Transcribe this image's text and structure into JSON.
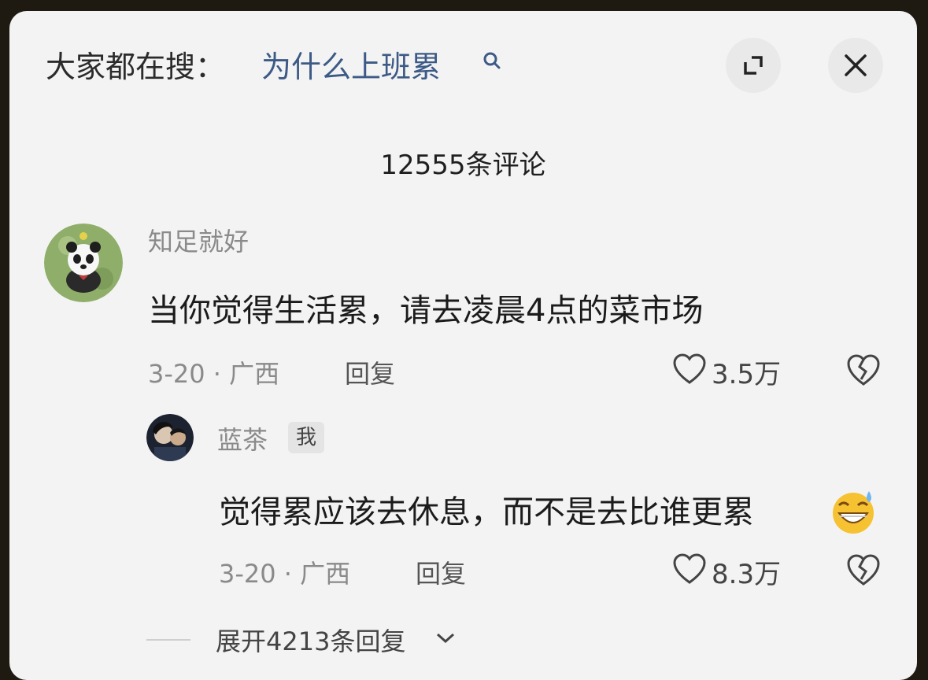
{
  "header": {
    "search_prefix": "大家都在搜：",
    "search_query": "为什么上班累",
    "expand_icon": "expand-icon",
    "close_icon": "close-icon"
  },
  "comment_count_label": "12555条评论",
  "comments": [
    {
      "username": "知足就好",
      "avatar": "panda-avatar",
      "text": "当你觉得生活累，请去凌晨4点的菜市场",
      "meta": "3-20 · 广西",
      "reply_label": "回复",
      "likes": "3.5万",
      "replies": [
        {
          "username": "蓝茶",
          "badge": "我",
          "avatar": "person-avatar",
          "text": "觉得累应该去休息，而不是去比谁更累",
          "emoji": "grinning-sweat-emoji",
          "meta": "3-20 · 广西",
          "reply_label": "回复",
          "likes": "8.3万"
        }
      ]
    }
  ],
  "expand_replies_label": "展开4213条回复",
  "colors": {
    "background": "#f3f3f3",
    "search_query": "#3d5a86",
    "muted_text": "#8a8a8a"
  }
}
